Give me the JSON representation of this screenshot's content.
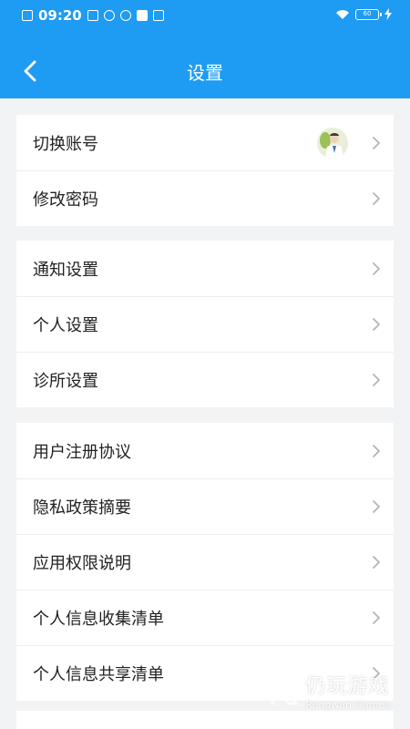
{
  "status_bar": {
    "time": "09:20",
    "battery": "60"
  },
  "header": {
    "title": "设置"
  },
  "groups": [
    {
      "items": [
        {
          "label": "切换账号"
        },
        {
          "label": "修改密码"
        }
      ]
    },
    {
      "items": [
        {
          "label": "通知设置"
        },
        {
          "label": "个人设置"
        },
        {
          "label": "诊所设置"
        }
      ]
    },
    {
      "items": [
        {
          "label": "用户注册协议"
        },
        {
          "label": "隐私政策摘要"
        },
        {
          "label": "应用权限说明"
        },
        {
          "label": "个人信息收集清单"
        },
        {
          "label": "个人信息共享清单"
        }
      ]
    }
  ],
  "watermark": {
    "cn": "仍玩游戏",
    "en": "Rengwan Games"
  },
  "colors": {
    "header": "#1e9bf3",
    "background": "#f2f3f5",
    "card": "#ffffff",
    "chevron": "#b4b4b4"
  },
  "icons": {
    "back": "chevron-left-icon",
    "row_arrow": "chevron-right-icon",
    "wifi": "wifi-icon",
    "battery": "battery-icon",
    "charging": "bolt-icon"
  }
}
